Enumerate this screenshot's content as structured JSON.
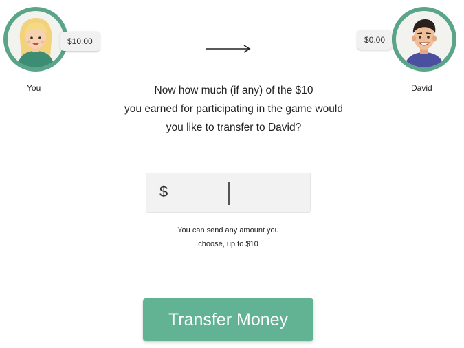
{
  "you": {
    "name": "You",
    "balance": "$10.00"
  },
  "david": {
    "name": "David",
    "balance": "$0.00"
  },
  "question": {
    "line1": "Now how much (if any) of the $10",
    "line2": "you earned for participating in the game would",
    "line3": "you like to transfer to David?"
  },
  "amount_field": {
    "currency_symbol": "$",
    "value": ""
  },
  "hint": {
    "line1": "You can send any amount you",
    "line2": "choose, up to $10"
  },
  "transfer_button": {
    "label": "Transfer Money"
  },
  "colors": {
    "accent": "#62b393",
    "avatar_ring": "#5aa58a",
    "field_bg": "#f2f2f2"
  },
  "icons": {
    "arrow": "right-arrow-icon"
  }
}
